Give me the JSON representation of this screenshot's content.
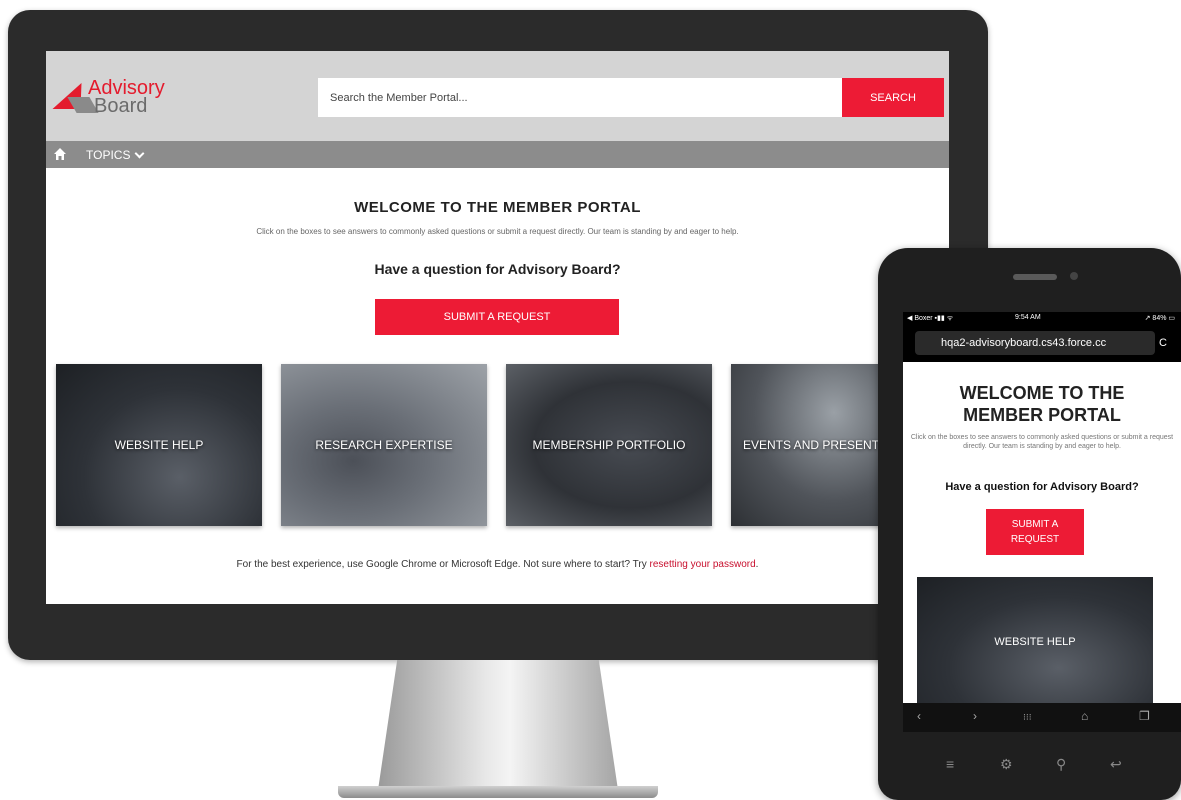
{
  "desktop": {
    "logo": {
      "line1": "Advisory",
      "line2": "Board"
    },
    "search": {
      "placeholder": "Search the Member Portal...",
      "button_label": "SEARCH"
    },
    "nav": {
      "topics_label": "TOPICS"
    },
    "welcome_title": "WELCOME TO THE MEMBER PORTAL",
    "welcome_subtext": "Click on the boxes to see answers to commonly asked questions or submit a request directly. Our team is standing by and eager to help.",
    "question": "Have a question for Advisory Board?",
    "submit_label": "SUBMIT A REQUEST",
    "tiles": [
      {
        "label": "WEBSITE HELP"
      },
      {
        "label": "RESEARCH EXPERTISE"
      },
      {
        "label": "MEMBERSHIP PORTFOLIO"
      },
      {
        "label": "EVENTS AND PRESENT"
      }
    ],
    "footer": {
      "text": "For the best experience, use Google Chrome or Microsoft Edge. Not sure where to start? Try ",
      "link": "resetting your password",
      "end": "."
    }
  },
  "mobile": {
    "status": {
      "carrier": "◀ Boxer ▪▮▮ ᯤ",
      "time": "9:54 AM",
      "battery": "↗ 84% ▭"
    },
    "url": "hqa2-advisoryboard.cs43.force.cc",
    "reload_icon": "C",
    "welcome_title": "WELCOME TO THE MEMBER PORTAL",
    "welcome_subtext": "Click on the boxes to see answers to commonly asked questions or submit a request directly. Our team is standing by and eager to help.",
    "question": "Have a question for Advisory Board?",
    "submit_label": "SUBMIT A REQUEST",
    "tile_label": "WEBSITE HELP",
    "nav_icons": {
      "back": "‹",
      "forward": "›",
      "grid": "⁝⁝⁝",
      "home": "⌂",
      "tabs": "❐"
    },
    "hardware_keys": {
      "menu": "≡",
      "settings": "⚙",
      "search": "⚲",
      "back": "↩"
    }
  }
}
